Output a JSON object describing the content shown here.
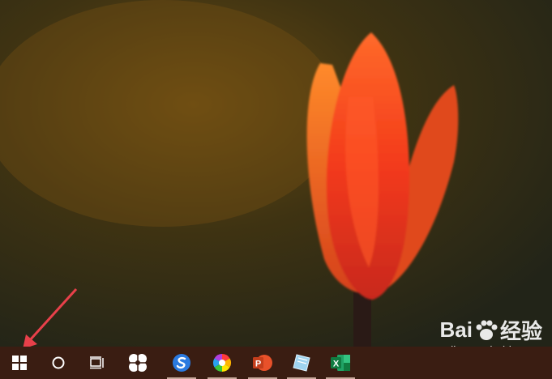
{
  "desktop": {
    "wallpaper": "orange-tulip-photo"
  },
  "watermark": {
    "brand_left": "Bai",
    "brand_right": "经验",
    "url": "jingyan.baidu.com"
  },
  "taskbar": {
    "background": "#3a1d12",
    "items": [
      {
        "name": "start-button",
        "icon": "windows-logo-icon"
      },
      {
        "name": "search-button",
        "icon": "cortana-circle-icon"
      },
      {
        "name": "task-view-button",
        "icon": "task-view-icon"
      },
      {
        "name": "app-1",
        "icon": "pinwheel-icon"
      },
      {
        "name": "app-sogou",
        "icon": "sogou-s-icon"
      },
      {
        "name": "app-2",
        "icon": "rainbow-swirl-icon"
      },
      {
        "name": "app-powerpoint",
        "icon": "powerpoint-icon",
        "letter": "P"
      },
      {
        "name": "app-3",
        "icon": "glass-notes-icon"
      },
      {
        "name": "app-excel",
        "icon": "excel-icon",
        "letter": "X"
      }
    ]
  },
  "annotation": {
    "arrow_color": "#e8404a"
  }
}
